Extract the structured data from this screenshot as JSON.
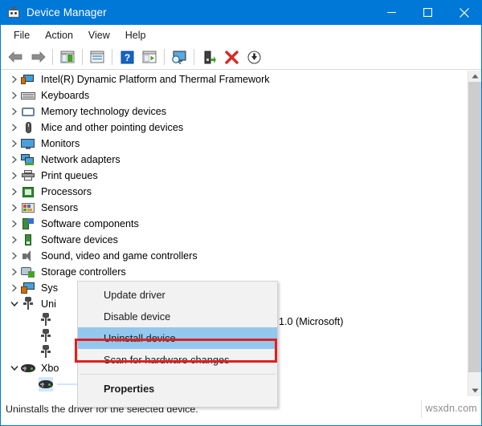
{
  "window": {
    "title": "Device Manager",
    "icon": "device-manager-icon",
    "minimize_label": "Minimize",
    "maximize_label": "Maximize",
    "close_label": "Close"
  },
  "menubar": {
    "items": [
      {
        "label": "File"
      },
      {
        "label": "Action"
      },
      {
        "label": "View"
      },
      {
        "label": "Help"
      }
    ]
  },
  "toolbar": {
    "buttons": [
      {
        "name": "back-button",
        "icon": "arrow-left-icon"
      },
      {
        "name": "forward-button",
        "icon": "arrow-right-icon"
      },
      {
        "name": "show-hide-console-tree-button",
        "icon": "console-tree-icon"
      },
      {
        "name": "properties-button",
        "icon": "properties-icon"
      },
      {
        "name": "help-button",
        "icon": "help-icon"
      },
      {
        "name": "show-hide-action-pane-button",
        "icon": "action-pane-icon"
      },
      {
        "name": "update-driver-button",
        "icon": "update-driver-icon"
      },
      {
        "name": "scan-for-hardware-changes-button",
        "icon": "scan-hardware-icon"
      },
      {
        "name": "uninstall-device-button",
        "icon": "red-x-icon"
      },
      {
        "name": "disable-device-button",
        "icon": "down-arrow-circle-icon"
      }
    ]
  },
  "tree": {
    "rows": [
      {
        "label": "Intel(R) Dynamic Platform and Thermal Framework",
        "icon": "intel-platform-icon",
        "expander": "collapsed",
        "indent": 0,
        "selected": false
      },
      {
        "label": "Keyboards",
        "icon": "keyboard-icon",
        "expander": "collapsed",
        "indent": 0,
        "selected": false
      },
      {
        "label": "Memory technology devices",
        "icon": "memory-icon",
        "expander": "collapsed",
        "indent": 0,
        "selected": false
      },
      {
        "label": "Mice and other pointing devices",
        "icon": "mouse-icon",
        "expander": "collapsed",
        "indent": 0,
        "selected": false
      },
      {
        "label": "Monitors",
        "icon": "monitor-icon",
        "expander": "collapsed",
        "indent": 0,
        "selected": false
      },
      {
        "label": "Network adapters",
        "icon": "network-icon",
        "expander": "collapsed",
        "indent": 0,
        "selected": false
      },
      {
        "label": "Print queues",
        "icon": "printer-icon",
        "expander": "collapsed",
        "indent": 0,
        "selected": false
      },
      {
        "label": "Processors",
        "icon": "processor-icon",
        "expander": "collapsed",
        "indent": 0,
        "selected": false
      },
      {
        "label": "Sensors",
        "icon": "sensor-icon",
        "expander": "collapsed",
        "indent": 0,
        "selected": false
      },
      {
        "label": "Software components",
        "icon": "software-component-icon",
        "expander": "collapsed",
        "indent": 0,
        "selected": false
      },
      {
        "label": "Software devices",
        "icon": "software-device-icon",
        "expander": "collapsed",
        "indent": 0,
        "selected": false
      },
      {
        "label": "Sound, video and game controllers",
        "icon": "sound-icon",
        "expander": "collapsed",
        "indent": 0,
        "selected": false
      },
      {
        "label": "Storage controllers",
        "icon": "storage-controller-icon",
        "expander": "collapsed",
        "indent": 0,
        "selected": false
      },
      {
        "label": "Sys",
        "icon": "system-device-icon",
        "expander": "collapsed",
        "indent": 0,
        "selected": false
      },
      {
        "label": "Uni",
        "icon": "usb-icon",
        "expander": "expanded",
        "indent": 0,
        "selected": false
      },
      {
        "label": "",
        "icon": "usb-icon",
        "expander": "none",
        "indent": 1,
        "selected": false
      },
      {
        "label": "",
        "icon": "usb-icon",
        "expander": "none",
        "indent": 1,
        "selected": false
      },
      {
        "label": "",
        "icon": "usb-icon",
        "expander": "none",
        "indent": 1,
        "selected": false
      },
      {
        "label": "Xbo",
        "icon": "gamepad-icon",
        "expander": "expanded",
        "indent": 0,
        "selected": false
      },
      {
        "label": "",
        "icon": "gamepad-icon",
        "expander": "none",
        "indent": 1,
        "selected": true
      }
    ],
    "partial_device_text": "1.0 (Microsoft)"
  },
  "context_menu": {
    "items": [
      {
        "label": "Update driver",
        "highlighted": false,
        "bold": false
      },
      {
        "label": "Disable device",
        "highlighted": false,
        "bold": false
      },
      {
        "label": "Uninstall device",
        "highlighted": true,
        "bold": false
      },
      {
        "label": "Scan for hardware changes",
        "highlighted": false,
        "bold": false
      },
      {
        "label": "Properties",
        "highlighted": false,
        "bold": true
      }
    ],
    "highlight_color": "#93c7ee",
    "annotation_box_color": "#e02020"
  },
  "statusbar": {
    "text": "Uninstalls the driver for the selected device."
  },
  "watermark": {
    "text": "wsxdn.com"
  },
  "colors": {
    "titlebar": "#0078d7",
    "selection": "#cde8ff",
    "menu_background": "#f2f2f2"
  }
}
